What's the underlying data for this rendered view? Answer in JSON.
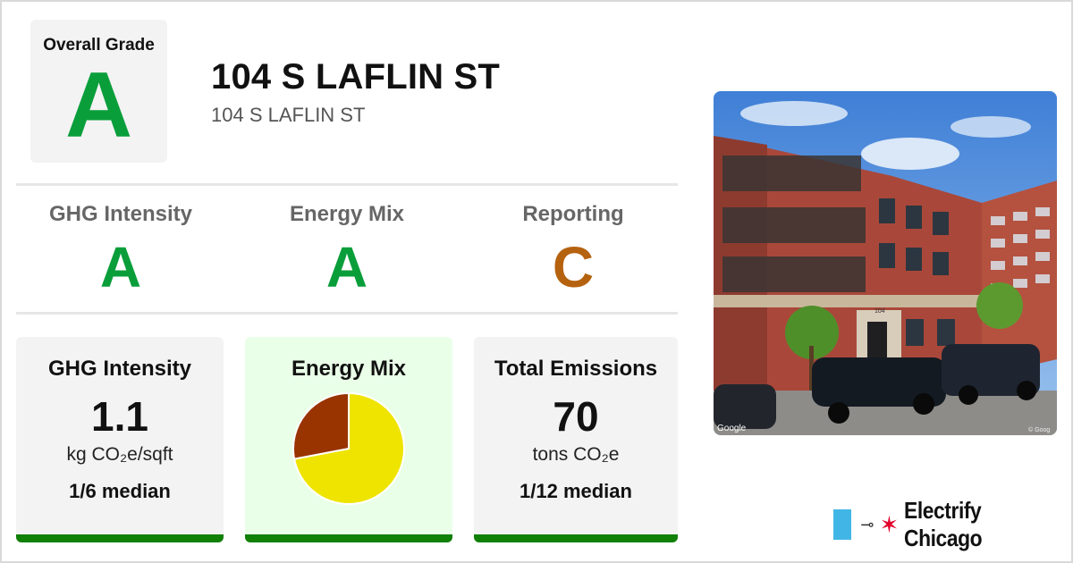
{
  "overall": {
    "label": "Overall Grade",
    "grade": "A"
  },
  "address": {
    "title": "104 S LAFLIN ST",
    "subtitle": "104 S LAFLIN ST"
  },
  "scores": [
    {
      "label": "GHG Intensity",
      "grade": "A",
      "color": "#0a9e3b"
    },
    {
      "label": "Energy Mix",
      "grade": "A",
      "color": "#0a9e3b"
    },
    {
      "label": "Reporting",
      "grade": "C",
      "color": "#b5620f"
    }
  ],
  "cards": {
    "ghg": {
      "title": "GHG Intensity",
      "value": "1.1",
      "unit": "kg CO₂e/sqft",
      "median": "1/6 median"
    },
    "mix": {
      "title": "Energy Mix",
      "chart": {
        "type": "pie",
        "slices": [
          {
            "value": 72,
            "color": "#eee400"
          },
          {
            "value": 28,
            "color": "#993300"
          }
        ]
      }
    },
    "emissions": {
      "title": "Total Emissions",
      "value": "70",
      "unit": "tons CO₂e",
      "median": "1/12 median"
    }
  },
  "photo": {
    "watermark_left": "Google",
    "watermark_right": "© Goog",
    "door_number": "104"
  },
  "brand": {
    "name": "Electrify Chicago",
    "icons": [
      "plug-icon",
      "star-icon"
    ]
  },
  "colors": {
    "grade_a": "#0a9e3b",
    "grade_c": "#b5620f",
    "accent_bar": "#118007",
    "mix_highlight": "#eaffe8"
  }
}
